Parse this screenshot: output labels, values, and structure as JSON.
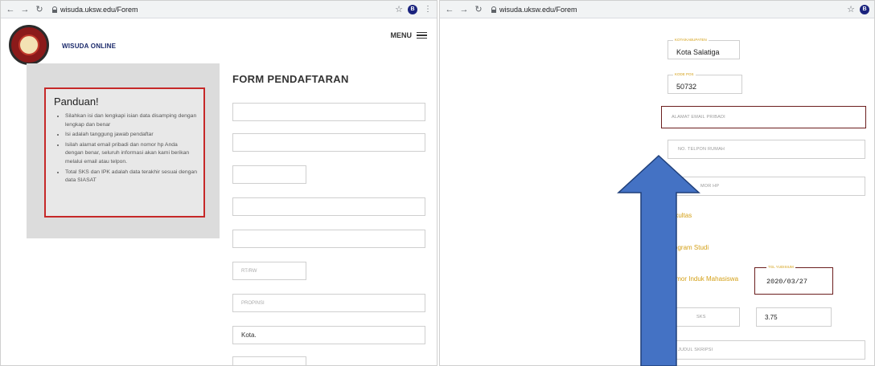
{
  "left": {
    "browser": {
      "url": "wisuda.uksw.edu/Forem",
      "profile_initial": "B"
    },
    "site_name": "WISUDA ONLINE",
    "menu_label": "MENU",
    "guide": {
      "title": "Panduan!",
      "items": [
        "Silahkan isi dan lengkapi isian data disamping dengan lengkap dan benar",
        "Isi adalah tanggung jawab pendaftar",
        "Isilah alamat email pribadi dan nomor hp Anda dengan benar, seluruh informasi akan kami berikan melalui email atau telpon.",
        "Total SKS dan IPK adalah data terakhir sesuai dengan data SIASAT"
      ]
    },
    "form_title": "FORM PENDAFTARAN",
    "fields": {
      "rt_rw_placeholder": "RT/RW",
      "provinsi_placeholder": "PROPINSI",
      "kota_value": "Kota."
    }
  },
  "right": {
    "browser": {
      "url": "wisuda.uksw.edu/Forem",
      "profile_initial": "B"
    },
    "kota": {
      "legend": "KOTA/KABUPATEN",
      "value": "Kota Salatiga"
    },
    "kode_pos": {
      "legend": "KODE POS",
      "value": "50732"
    },
    "email_placeholder": "ALAMAT EMAIL PRIBADI",
    "telpon_placeholder": "NO. TELPON RUMAH",
    "hp_placeholder": "MOR HP",
    "fakultas_label": "Fakultas",
    "prodi_label": "Program Studi",
    "nim_label": "Nomor Induk Mahasiswa",
    "tgl": {
      "legend": "TGL YUDISIUM",
      "value": "2020/03/27"
    },
    "sks_placeholder": "SKS",
    "ipk_value": "3.75",
    "judul_placeholder": "JUDUL SKRIPSI"
  },
  "colors": {
    "guide_border": "#c62828",
    "highlight_border": "#6b1e1e",
    "label_gold": "#d4a017",
    "arrow_fill": "#4472c4",
    "arrow_stroke": "#1f3f7a"
  }
}
